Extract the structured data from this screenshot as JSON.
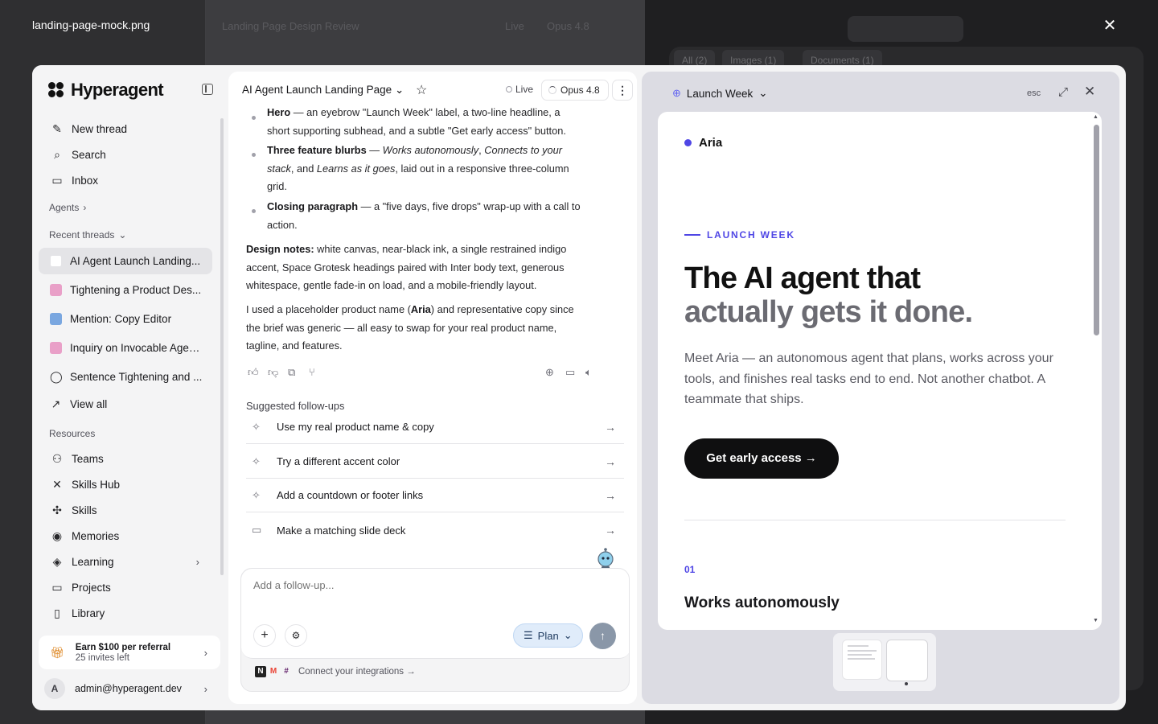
{
  "viewer": {
    "filename": "landing-page-mock.png"
  },
  "background": {
    "doc_title": "Landing Page Design Review",
    "live": "Live",
    "model": "Opus 4.8",
    "chips": [
      "All (2)",
      "Images (1)",
      "Documents (1)"
    ]
  },
  "sidebar": {
    "brand": "Hyperagent",
    "primary": [
      {
        "label": "New thread",
        "icon": "new-thread-icon"
      },
      {
        "label": "Search",
        "icon": "search-icon"
      },
      {
        "label": "Inbox",
        "icon": "inbox-icon"
      }
    ],
    "agents_label": "Agents",
    "recent_label": "Recent threads",
    "threads": [
      {
        "label": "AI Agent Launch Landing...",
        "color": "#ffffff"
      },
      {
        "label": "Tightening a Product Des...",
        "color": "#e9a0c8"
      },
      {
        "label": "Mention: Copy Editor",
        "color": "#7aa7e0"
      },
      {
        "label": "Inquiry on Invocable Agen...",
        "color": "#e9a0c8"
      },
      {
        "label": "Sentence Tightening and ...",
        "color": "chat"
      }
    ],
    "view_all": "View all",
    "resources_label": "Resources",
    "resources": [
      {
        "label": "Teams",
        "icon": "teams-icon"
      },
      {
        "label": "Skills Hub",
        "icon": "skills-hub-icon"
      },
      {
        "label": "Skills",
        "icon": "skills-icon"
      },
      {
        "label": "Memories",
        "icon": "memories-icon"
      },
      {
        "label": "Learning",
        "icon": "learning-icon"
      },
      {
        "label": "Projects",
        "icon": "projects-icon"
      },
      {
        "label": "Library",
        "icon": "library-icon"
      }
    ],
    "referral_title": "Earn $100 per referral",
    "referral_sub": "25 invites left",
    "user_initial": "A",
    "user_email": "admin@hyperagent.dev"
  },
  "chat": {
    "title": "AI Agent Launch Landing Page",
    "live": "Live",
    "model": "Opus 4.8",
    "hero_label": "Hero",
    "hero_l1": " — an eyebrow \"Launch Week\" label, a two-line headline, a",
    "hero_l2": "short supporting subhead, and a subtle \"Get early access\" button.",
    "feat_label": "Three feature blurbs",
    "feat_l1_mid": " — ",
    "feat_i1": "Works autonomously",
    "feat_c1": ", ",
    "feat_i2a": "Connects to your",
    "feat_i2b": "stack",
    "feat_c2": ", and ",
    "feat_i3": "Learns as it goes",
    "feat_tail": ", laid out in a responsive three-column",
    "feat_l3": "grid.",
    "close_label": "Closing paragraph",
    "close_l1": " — a \"five days, five drops\" wrap-up with a call to",
    "close_l2": "action.",
    "design_label": "Design notes:",
    "design_l1": " white canvas, near-black ink, a single restrained indigo",
    "design_l2": "accent, Space Grotesk headings paired with Inter body text, generous",
    "design_l3": "whitespace, gentle fade-in on load, and a mobile-friendly layout.",
    "note_l1a": "I used a placeholder product name (",
    "note_name": "Aria",
    "note_l1b": ") and representative copy since",
    "note_l2": "the brief was generic — all easy to swap for your real product name,",
    "note_l3": "tagline, and features.",
    "followups_label": "Suggested follow-ups",
    "followups": [
      {
        "label": "Use my real product name & copy",
        "icon": "sparkle-icon"
      },
      {
        "label": "Try a different accent color",
        "icon": "sparkle-icon"
      },
      {
        "label": "Add a countdown or footer links",
        "icon": "sparkle-icon"
      },
      {
        "label": "Make a matching slide deck",
        "icon": "slides-icon"
      }
    ],
    "composer_placeholder": "Add a follow-up...",
    "plan_label": "Plan",
    "integrations_label": "Connect your integrations →"
  },
  "preview": {
    "title": "Launch Week",
    "esc": "esc",
    "brand": "Aria",
    "eyebrow": "LAUNCH WEEK",
    "headline_1": "The AI agent that",
    "headline_2": "actually gets it done.",
    "subhead": "Meet Aria — an autonomous agent that plans, works across your tools, and finishes real tasks end to end. Not another chatbot. A teammate that ships.",
    "cta": "Get early access  →",
    "feature_num": "01",
    "feature_title": "Works autonomously",
    "accent": "#4f46e5"
  }
}
